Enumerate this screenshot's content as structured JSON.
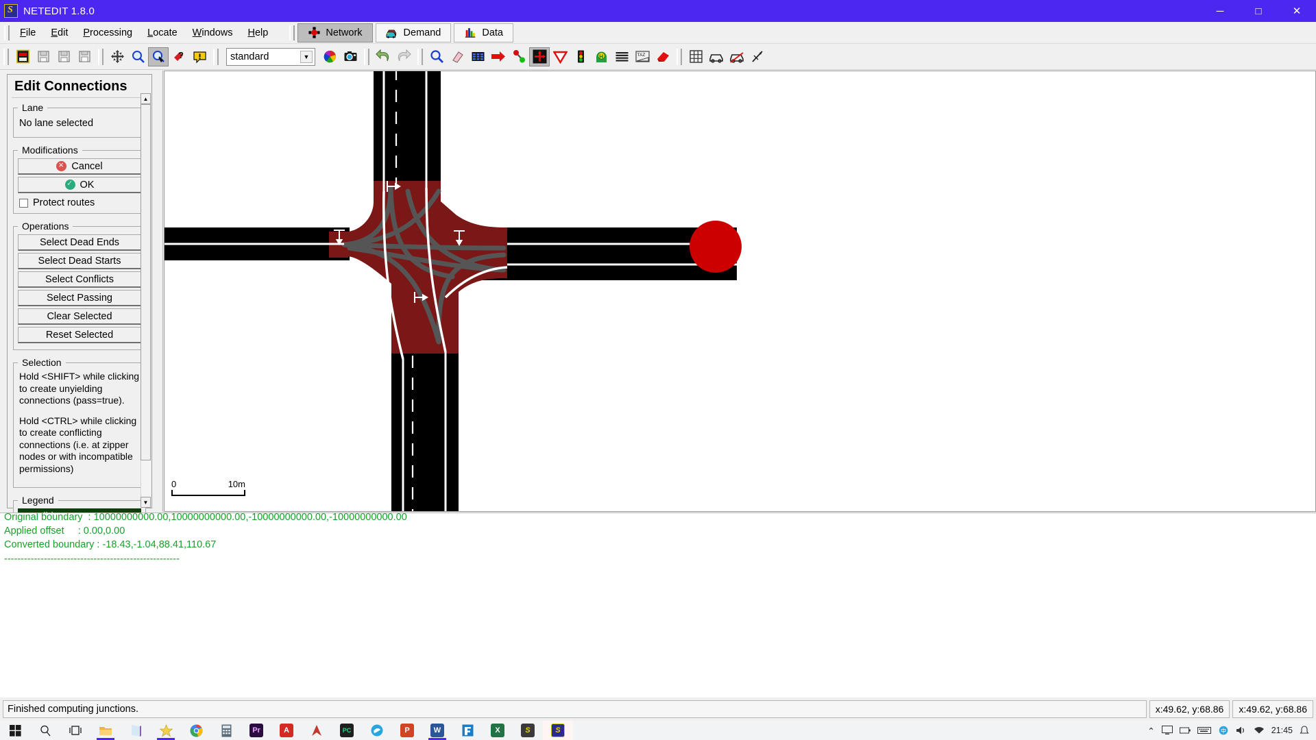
{
  "window": {
    "title": "NETEDIT 1.8.0",
    "app_icon": "netedit-icon",
    "minimize": "─",
    "maximize": "□",
    "close": "✕"
  },
  "menubar": {
    "items": [
      {
        "label": "File",
        "mnemonic": "F"
      },
      {
        "label": "Edit",
        "mnemonic": "E"
      },
      {
        "label": "Processing",
        "mnemonic": "P"
      },
      {
        "label": "Locate",
        "mnemonic": "L"
      },
      {
        "label": "Windows",
        "mnemonic": "W"
      },
      {
        "label": "Help",
        "mnemonic": "H"
      }
    ],
    "mode_tabs": [
      {
        "label": "Network",
        "icon": "network-mode-icon",
        "active": true
      },
      {
        "label": "Demand",
        "icon": "demand-mode-icon",
        "active": false
      },
      {
        "label": "Data",
        "icon": "data-mode-icon",
        "active": false
      }
    ]
  },
  "toolbar": {
    "buttons": [
      {
        "name": "new-network-icon",
        "tooltip": "New Network"
      },
      {
        "name": "open-network-icon",
        "tooltip": "Open Network"
      },
      {
        "name": "save-network-icon",
        "tooltip": "Save Network"
      },
      {
        "name": "save-network-as-icon",
        "tooltip": "Save Network As"
      },
      {
        "name": "recenter-view-icon",
        "tooltip": "Recenter View"
      },
      {
        "name": "zoom-style-icon",
        "tooltip": "Zoom Style"
      },
      {
        "name": "edit-viewport-icon",
        "tooltip": "Edit Viewport",
        "pressed": true
      },
      {
        "name": "help-cursor-icon",
        "tooltip": "Help"
      },
      {
        "name": "warnings-icon",
        "tooltip": "Warnings"
      },
      {
        "name": "color-scheme-icon",
        "tooltip": "Edit Coloring Schemes"
      },
      {
        "name": "snapshot-camera-icon",
        "tooltip": "Make Snapshot"
      },
      {
        "name": "undo-icon",
        "tooltip": "Undo"
      },
      {
        "name": "redo-icon",
        "tooltip": "Redo"
      },
      {
        "name": "inspect-mode-icon",
        "tooltip": "Inspect Mode"
      },
      {
        "name": "delete-mode-icon",
        "tooltip": "Delete Mode"
      },
      {
        "name": "select-mode-icon",
        "tooltip": "Select Mode"
      },
      {
        "name": "move-mode-icon",
        "tooltip": "Move Mode"
      },
      {
        "name": "create-edge-icon",
        "tooltip": "Create Edge Mode"
      },
      {
        "name": "connection-mode-icon",
        "tooltip": "Connection Mode",
        "pressed": true
      },
      {
        "name": "prohibition-mode-icon",
        "tooltip": "Prohibition Mode"
      },
      {
        "name": "traffic-light-mode-icon",
        "tooltip": "Traffic Light Mode"
      },
      {
        "name": "additional-mode-icon",
        "tooltip": "Additional Mode"
      },
      {
        "name": "crossing-mode-icon",
        "tooltip": "Crossing Mode"
      },
      {
        "name": "taz-mode-icon",
        "tooltip": "TAZ Mode"
      },
      {
        "name": "shape-mode-icon",
        "tooltip": "Shape Mode"
      },
      {
        "name": "grid-icon",
        "tooltip": "Show Grid"
      },
      {
        "name": "vehicle-icon",
        "tooltip": "Vehicles"
      },
      {
        "name": "vehicle-off-icon",
        "tooltip": "Hide Vehicles"
      },
      {
        "name": "route-icon",
        "tooltip": "Routes"
      }
    ],
    "scheme_select": {
      "value": "standard",
      "arrow": "▼"
    }
  },
  "left_panel": {
    "title": "Edit Connections",
    "lane_group": {
      "legend": "Lane",
      "text": "No lane selected"
    },
    "modifications_group": {
      "legend": "Modifications",
      "cancel_label": "Cancel",
      "ok_label": "OK",
      "protect_routes_label": "Protect routes",
      "protect_routes_checked": false
    },
    "operations_group": {
      "legend": "Operations",
      "buttons": [
        "Select Dead Ends",
        "Select Dead Starts",
        "Select Conflicts",
        "Select Passing",
        "Clear Selected",
        "Reset Selected"
      ]
    },
    "selection_group": {
      "legend": "Selection",
      "paragraphs": [
        "Hold <SHIFT> while clicking to create unyielding connections (pass=true).",
        "Hold <CTRL> while clicking to create conflicting connections (i.e. at zipper nodes or with incompatible permissions)"
      ]
    },
    "legend_group": {
      "legend": "Legend",
      "entries": [
        {
          "label": "Possible Target",
          "bg": "#0b4008",
          "fg": "#ffffff"
        },
        {
          "label": "",
          "bg": "#19e8ef",
          "fg": "#000000"
        }
      ]
    },
    "scrollbar": {
      "up_arrow": "▲",
      "down_arrow": "▼"
    }
  },
  "canvas": {
    "scale": {
      "start": "0",
      "end": "10m"
    },
    "background": "#ffffff",
    "junction_color": "#7a1717",
    "road_color": "#000000",
    "marker_color": "#cc0000"
  },
  "log": {
    "lines": [
      "Original boundary  : 10000000000.00,10000000000.00,-10000000000.00,-10000000000.00",
      "Applied offset     : 0.00,0.00",
      "Converted boundary : -18.43,-1.04,88.41,110.67"
    ],
    "separator": "-----------------------------------------------------"
  },
  "statusbar": {
    "message": "Finished computing junctions.",
    "coord_left": "x:49.62, y:68.86",
    "coord_right": "x:49.62, y:68.86"
  },
  "taskbar": {
    "items": [
      {
        "name": "start-button-icon",
        "label": "",
        "color": "#1b1b1b"
      },
      {
        "name": "search-icon",
        "label": "",
        "color": "#1b1b1b"
      },
      {
        "name": "task-view-icon",
        "label": "",
        "color": "#1b1b1b"
      },
      {
        "name": "file-explorer-icon",
        "label": "",
        "color": "#f5b33c",
        "running": true
      },
      {
        "name": "onenote-icon",
        "label": "",
        "color": "#7b3fa0"
      },
      {
        "name": "star-app-icon",
        "label": "",
        "color": "#f2d04b",
        "running": true
      },
      {
        "name": "chrome-icon",
        "label": "",
        "color": "#34a853"
      },
      {
        "name": "calculator-icon",
        "label": "",
        "color": "#5b6b78"
      },
      {
        "name": "premiere-icon",
        "label": "Pr",
        "color": "#2a0c3f"
      },
      {
        "name": "acrobat-icon",
        "label": "A",
        "color": "#d42a23"
      },
      {
        "name": "autocad-icon",
        "label": "",
        "color": "#c0392b"
      },
      {
        "name": "pycharm-icon",
        "label": "PC",
        "color": "#21d789"
      },
      {
        "name": "bluebird-app-icon",
        "label": "",
        "color": "#2aa5e0"
      },
      {
        "name": "powerpoint-icon",
        "label": "P",
        "color": "#d04423"
      },
      {
        "name": "word-icon",
        "label": "W",
        "color": "#2b579a",
        "running": true
      },
      {
        "name": "editor-app-icon",
        "label": "",
        "color": "#1e7bc4"
      },
      {
        "name": "excel-icon",
        "label": "X",
        "color": "#217346"
      },
      {
        "name": "sumo-icon",
        "label": "S",
        "color": "#3a3a3a"
      },
      {
        "name": "netedit-taskbar-icon",
        "label": "S",
        "color": "#e8d400",
        "active": true
      }
    ],
    "tray": {
      "chevron": "⌃",
      "time": "21:45",
      "date": ""
    }
  }
}
